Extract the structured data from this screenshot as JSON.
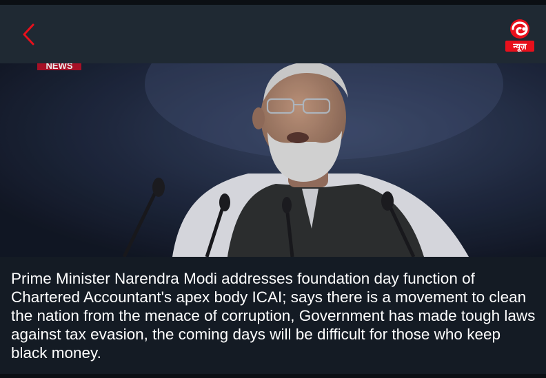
{
  "header": {
    "back_icon": "chevron-left-icon",
    "logo": {
      "icon": "dd-news-logo",
      "text": "न्यूज़",
      "color": "#e8101c"
    }
  },
  "hero": {
    "watermark": "NEWS",
    "description_hidden": ""
  },
  "article": {
    "headline": "Prime Minister Narendra Modi addresses foundation day function of Chartered Accountant's apex body ICAI; says there is a movement to clean the nation from the menace of corruption, Government has made tough laws against tax evasion, the coming days will be difficult for those who keep black money."
  },
  "colors": {
    "app_bar": "#1f2933",
    "background": "#141b24",
    "accent": "#e8101c",
    "text": "#ffffff"
  }
}
